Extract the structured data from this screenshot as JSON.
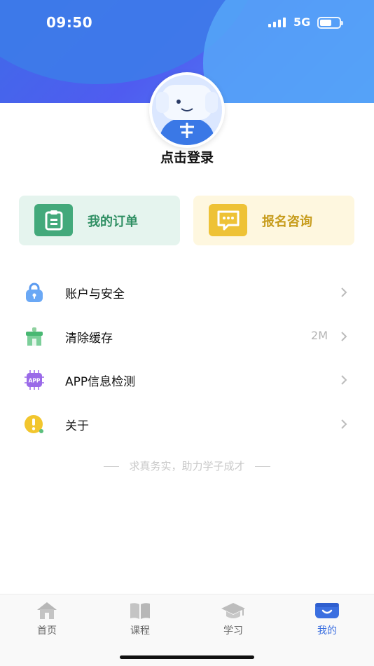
{
  "status_bar": {
    "time": "09:50",
    "network": "5G"
  },
  "profile": {
    "login_prompt": "点击登录"
  },
  "cards": [
    {
      "label": "我的订单",
      "icon": "clipboard-icon",
      "color": "#43a97b"
    },
    {
      "label": "报名咨询",
      "icon": "chat-bubble-icon",
      "color": "#eec236"
    }
  ],
  "menu": [
    {
      "label": "账户与安全",
      "value": "",
      "icon": "lock-icon"
    },
    {
      "label": "清除缓存",
      "value": "2M",
      "icon": "clear-cache-icon"
    },
    {
      "label": "APP信息检测",
      "value": "",
      "icon": "app-chip-icon"
    },
    {
      "label": "关于",
      "value": "",
      "icon": "info-alert-icon"
    }
  ],
  "slogan": "求真务实，助力学子成才",
  "tabs": [
    {
      "label": "首页",
      "icon": "home-icon",
      "active": false
    },
    {
      "label": "课程",
      "icon": "book-icon",
      "active": false
    },
    {
      "label": "学习",
      "icon": "graduation-cap-icon",
      "active": false
    },
    {
      "label": "我的",
      "icon": "profile-icon",
      "active": true
    }
  ],
  "colors": {
    "accent": "#3b6fe0",
    "header_gradient": [
      "#3f6be8",
      "#56a6f8"
    ]
  }
}
